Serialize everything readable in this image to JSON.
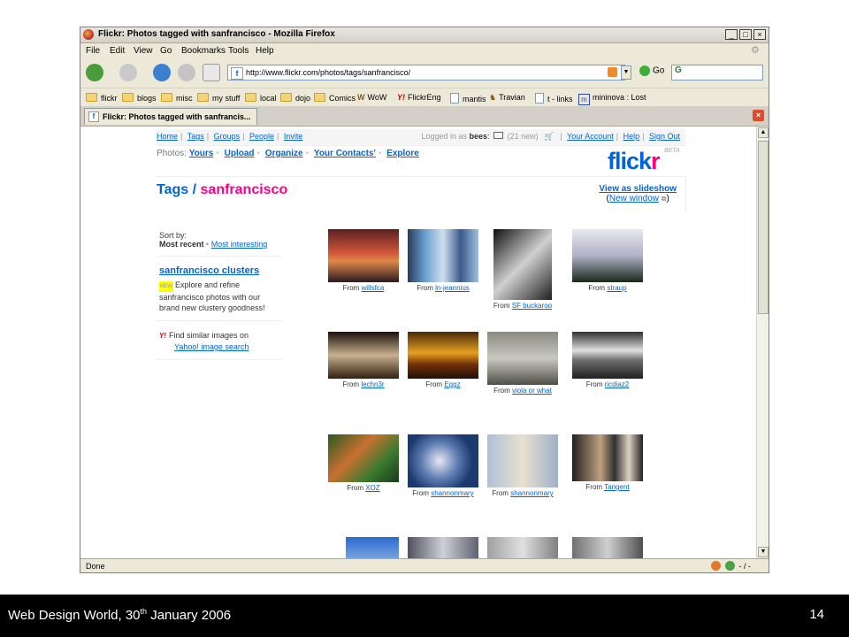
{
  "browser": {
    "title": "Flickr: Photos tagged with sanfrancisco - Mozilla Firefox",
    "menus": [
      "File",
      "Edit",
      "View",
      "Go",
      "Bookmarks",
      "Tools",
      "Help"
    ],
    "url": "http://www.flickr.com/photos/tags/sanfrancisco/",
    "go_label": "Go",
    "search_value": "G",
    "bookmarks": [
      "flickr",
      "blogs",
      "misc",
      "my stuff",
      "local",
      "dojo",
      "Comics",
      "WoW",
      "FlickrEng",
      "mantis",
      "Travian",
      "t - links",
      "mininova : Lost"
    ],
    "tab_title": "Flickr: Photos tagged with sanfrancis...",
    "status": "Done",
    "status_right": "- / -",
    "close_btn": "×",
    "min_btn": "_",
    "max_btn": "□"
  },
  "page": {
    "nav": [
      "Home",
      "Tags",
      "Groups",
      "People",
      "Invite"
    ],
    "logged_in_prefix": "Logged in as",
    "username": "bees",
    "new_count": "(21 new)",
    "account_links": [
      "Your Account",
      "Help",
      "Sign Out"
    ],
    "photos_label": "Photos:",
    "photos_links": [
      "Yours",
      "Upload",
      "Organize",
      "Your Contacts'",
      "Explore"
    ],
    "logo_flick": "flick",
    "logo_r": "r",
    "logo_beta": "BETA",
    "title_tags": "Tags",
    "title_slash": "/",
    "title_tag": "sanfrancisco",
    "slideshow": "View as slideshow",
    "new_window": "New window",
    "sort_by": "Sort by:",
    "most_recent": "Most recent",
    "most_interesting": "Most interesting",
    "clusters_title": "sanfrancisco clusters",
    "new_badge": "NEW",
    "clusters_text": "Explore and refine sanfrancisco photos with our brand new clustery goodness!",
    "yahoo_text": "Find similar images on",
    "yahoo_link": "Yahoo! image search",
    "from_label": "From",
    "photos": [
      {
        "user": "willsfca"
      },
      {
        "user": "ln-jeannius"
      },
      {
        "user": "SF buckaroo"
      },
      {
        "user": "straup"
      },
      {
        "user": "lechn3r"
      },
      {
        "user": "Eggz"
      },
      {
        "user": "viola or what"
      },
      {
        "user": "ricdiaz2"
      },
      {
        "user": "XOZ"
      },
      {
        "user": "shannonmary"
      },
      {
        "user": "shannonmary"
      },
      {
        "user": "Tangent"
      }
    ]
  },
  "slide": {
    "footer_text": "Web Design World, 30",
    "footer_sup": "th",
    "footer_text2": " January 2006",
    "page_number": "14"
  },
  "colors": {
    "flickr_blue": "#0063dc",
    "flickr_pink": "#ff0084"
  }
}
